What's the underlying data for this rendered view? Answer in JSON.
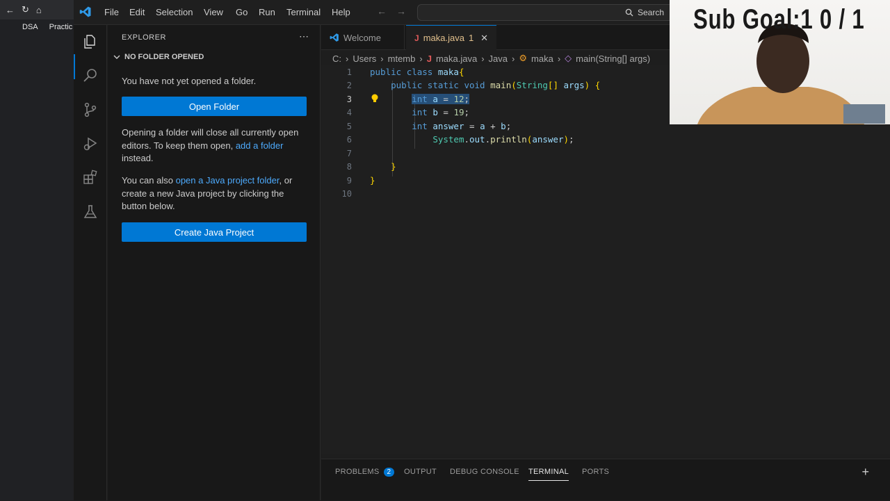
{
  "browser": {
    "bookmarks": [
      "DSA",
      "Practic"
    ]
  },
  "titlebar": {
    "menu": [
      "File",
      "Edit",
      "Selection",
      "View",
      "Go",
      "Run",
      "Terminal",
      "Help"
    ],
    "search_label": "Search"
  },
  "activity_bar": {
    "items": [
      "explorer-icon",
      "search-icon",
      "source-control-icon",
      "run-debug-icon",
      "extensions-icon",
      "testing-icon"
    ],
    "active": "explorer-icon"
  },
  "sidebar": {
    "title": "EXPLORER",
    "section": "NO FOLDER OPENED",
    "msg1": "You have not yet opened a folder.",
    "open_folder_button": "Open Folder",
    "msg2_a": "Opening a folder will close all currently open editors. To keep them open, ",
    "msg2_link": "add a folder",
    "msg2_b": " instead.",
    "msg3_a": "You can also ",
    "msg3_link": "open a Java project folder",
    "msg3_b": ", or create a new Java project by clicking the button below.",
    "create_project_button": "Create Java Project"
  },
  "tabs": [
    {
      "label": "Welcome",
      "active": false
    },
    {
      "label": "maka.java",
      "badge": "1",
      "active": true
    }
  ],
  "breadcrumbs": [
    "C:",
    "Users",
    "mtemb",
    "maka.java",
    "Java",
    "maka",
    "main(String[] args)"
  ],
  "editor": {
    "line_numbers": [
      "1",
      "2",
      "3",
      "4",
      "5",
      "6",
      "7",
      "8",
      "9",
      "10"
    ],
    "current_line": 3,
    "lines": [
      "public class maka{",
      "    public static void main(String[] args) {",
      "        int a = 12;",
      "        int b = 19;",
      "        int answer = a + b;",
      "            System.out.println(answer);",
      "",
      "    }",
      "}",
      ""
    ]
  },
  "panel": {
    "tabs": [
      "PROBLEMS",
      "OUTPUT",
      "DEBUG CONSOLE",
      "TERMINAL",
      "PORTS"
    ],
    "problems_count": "2",
    "active_tab": "TERMINAL"
  },
  "webcam": {
    "overlay_text": "Sub Goal:1  0 / 1"
  },
  "colors": {
    "accent": "#0078d4",
    "link": "#4daafc",
    "modified_tab": "#e2c08d"
  }
}
